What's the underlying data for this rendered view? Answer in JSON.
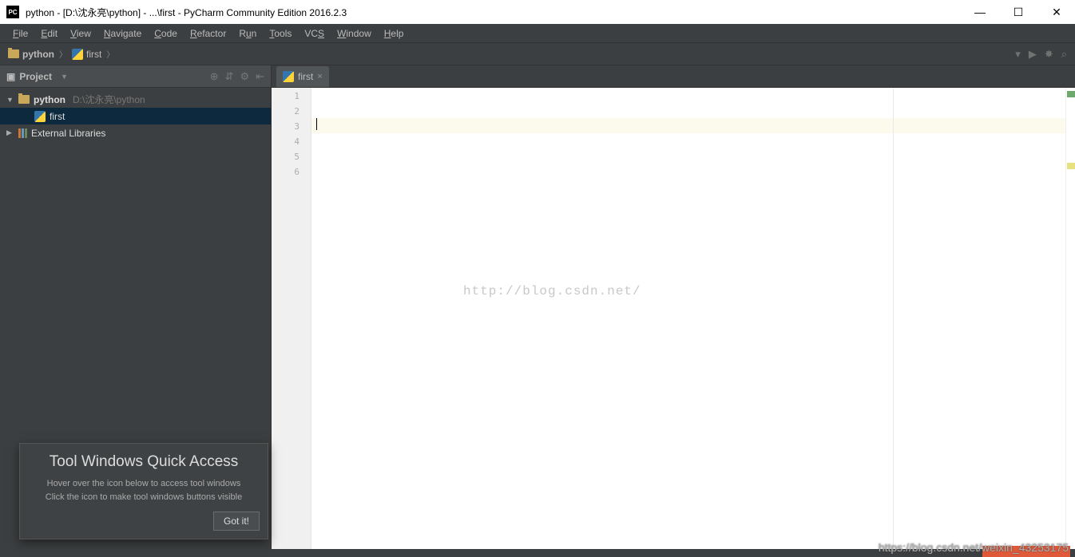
{
  "titlebar": {
    "app_badge": "PC",
    "title": "python - [D:\\沈永亮\\python] - ...\\first - PyCharm Community Edition 2016.2.3"
  },
  "menu": {
    "items": [
      "File",
      "Edit",
      "View",
      "Navigate",
      "Code",
      "Refactor",
      "Run",
      "Tools",
      "VCS",
      "Window",
      "Help"
    ]
  },
  "breadcrumb": {
    "project": "python",
    "file": "first"
  },
  "toolbar_right": {
    "run": "▶",
    "debug": "✸",
    "search": "⌕"
  },
  "sidebar": {
    "title": "Project",
    "tools": [
      "⊕",
      "⇵",
      "⚙",
      "⇤"
    ],
    "tree": {
      "root": {
        "name": "python",
        "path": "D:\\沈永亮\\python"
      },
      "file": {
        "name": "first"
      },
      "external": {
        "name": "External Libraries"
      }
    }
  },
  "editor": {
    "tab_name": "first",
    "lines": [
      "1",
      "2",
      "3",
      "4",
      "5",
      "6"
    ],
    "watermark": "http://blog.csdn.net/"
  },
  "popup": {
    "title": "Tool Windows Quick Access",
    "line1": "Hover over the icon below to access tool windows",
    "line2": "Click the icon to make tool windows buttons visible",
    "button": "Got it!"
  },
  "footer_wm": "https://blog.csdn.net/weixin_43253175"
}
